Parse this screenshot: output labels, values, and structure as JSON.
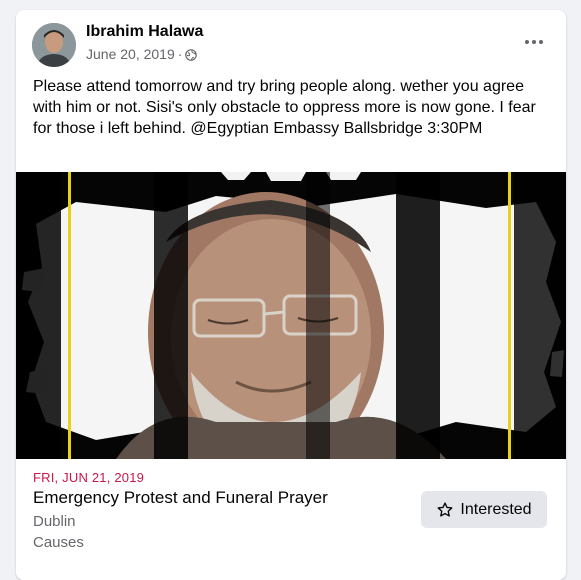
{
  "post": {
    "author": "Ibrahim Halawa",
    "date": "June 20, 2019",
    "separator": "·",
    "privacy_icon": "globe-icon",
    "more_icon": "more-horizontal-icon",
    "text": "Please attend tomorrow and try bring people along. wether you agree with him or not. Sisi's only obstacle to oppress more is now gone. I fear for those i left behind. @Egyptian Embassy Ballsbridge 3:30PM"
  },
  "event": {
    "date": "FRI, JUN 21, 2019",
    "title": "Emergency Protest and Funeral Prayer",
    "location": "Dublin",
    "category": "Causes",
    "interested_label": "Interested",
    "interested_icon": "star-outline-icon"
  },
  "colors": {
    "event_date": "#c9174a",
    "secondary_text": "#65676b",
    "button_bg": "#e4e6eb",
    "page_bg": "#f0f2f5"
  }
}
